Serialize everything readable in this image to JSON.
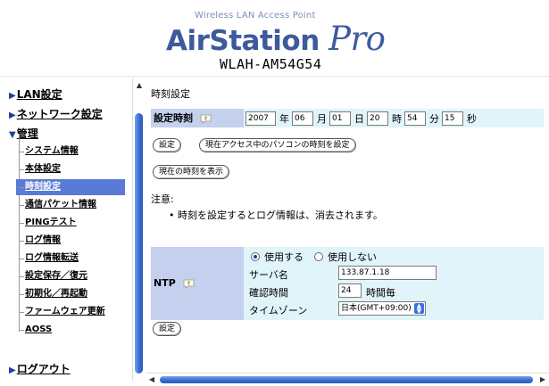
{
  "header": {
    "subtitle": "Wireless LAN Access Point",
    "brand": "AirStation",
    "brand_suffix": "Pro",
    "model": "WLAH-AM54G54"
  },
  "sidebar": {
    "lan": "LAN設定",
    "network": "ネットワーク設定",
    "admin": "管理",
    "items": [
      {
        "label": "システム情報"
      },
      {
        "label": "本体設定"
      },
      {
        "label": "時刻設定"
      },
      {
        "label": "通信パケット情報"
      },
      {
        "label": "PINGテスト"
      },
      {
        "label": "ログ情報"
      },
      {
        "label": "ログ情報転送"
      },
      {
        "label": "設定保存／復元"
      },
      {
        "label": "初期化／再起動"
      },
      {
        "label": "ファームウェア更新"
      },
      {
        "label": "AOSS"
      }
    ],
    "logout": "ログアウト"
  },
  "content": {
    "page_title": "時刻設定",
    "time_label": "設定時刻",
    "year": "2007",
    "year_unit": "年",
    "month": "06",
    "month_unit": "月",
    "day": "01",
    "day_unit": "日",
    "hour": "20",
    "hour_unit": "時",
    "minute": "54",
    "minute_unit": "分",
    "second": "15",
    "second_unit": "秒",
    "set_button": "設定",
    "set_from_pc_button": "現在アクセス中のパソコンの時刻を設定",
    "show_time_button": "現在の時刻を表示",
    "note_heading": "注意:",
    "note_item": "時刻を設定するとログ情報は、消去されます。",
    "ntp": {
      "label": "NTP",
      "use": "使用する",
      "not_use": "使用しない",
      "selected": "使用する",
      "server_label": "サーバ名",
      "server_value": "133.87.1.18",
      "interval_label": "確認時間",
      "interval_value": "24",
      "interval_unit": "時間毎",
      "tz_label": "タイムゾーン",
      "tz_value": "日本(GMT+09:00)"
    },
    "ntp_set_button": "設定"
  },
  "icons": {
    "help": "help-icon",
    "bullet": "•"
  },
  "colors": {
    "label_bg": "#c5d0ee",
    "row_bg": "#e0f4fa",
    "active_nav": "#5a7bd5",
    "brand": "#3d5a9c"
  }
}
